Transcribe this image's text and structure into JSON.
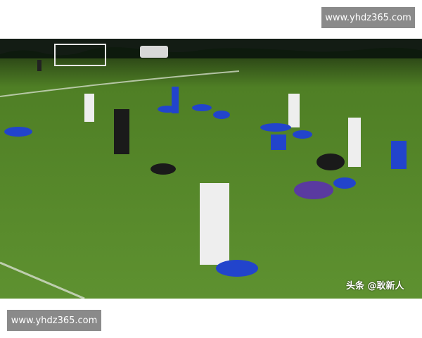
{
  "watermark": {
    "top_text": "www.yhdz365.com",
    "bottom_text": "www.yhdz365.com"
  },
  "photo": {
    "caption": "头条 @耿新人",
    "grass_color": "#5b8f2c",
    "kit_color": "#2244cc",
    "icon": "football-training-photo"
  }
}
